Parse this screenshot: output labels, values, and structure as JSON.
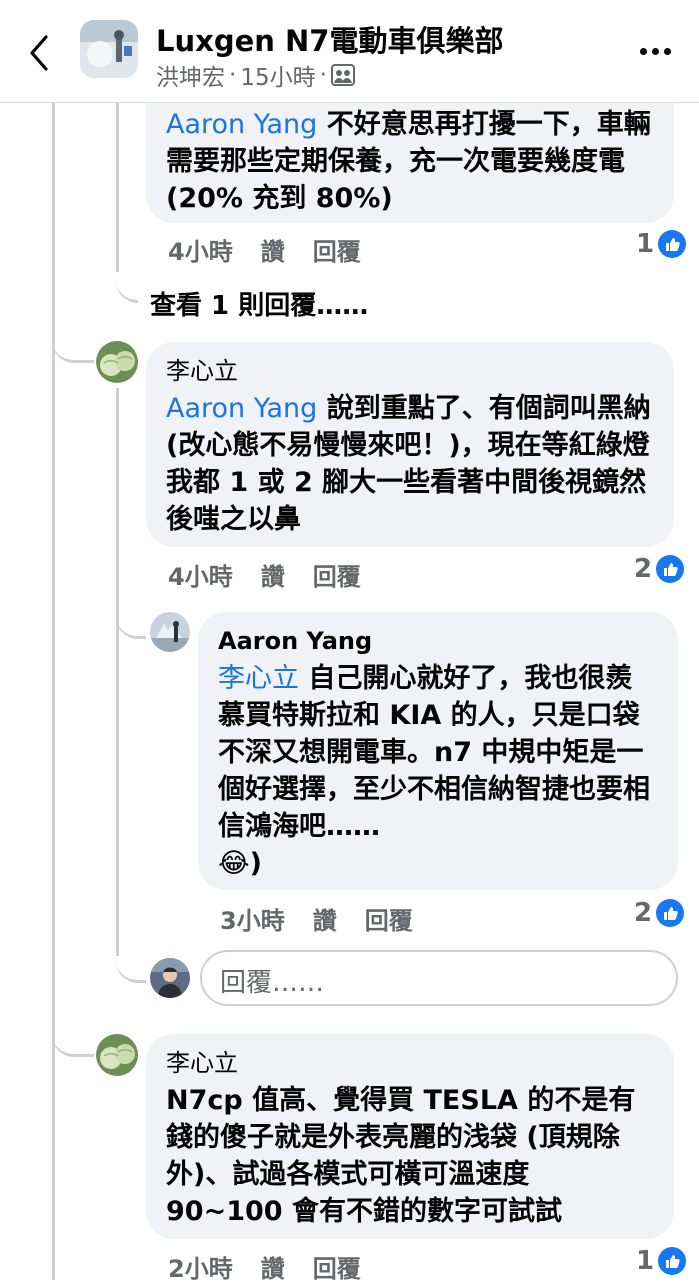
{
  "header": {
    "group_name": "Luxgen N7電動車俱樂部",
    "poster": "洪坤宏",
    "separator": "·",
    "time": "15小時",
    "separator2": "·"
  },
  "comments": [
    {
      "mention": "Aaron Yang",
      "text": " 不好意思再打擾一下，車輛需要那些定期保養，充一次電要幾度電 (20% 充到 80%)",
      "time": "4小時",
      "like": "讚",
      "reply": "回覆",
      "reactions": "1"
    },
    {
      "author": "李心立",
      "mention": "Aaron Yang",
      "text": " 說到重點了、有個詞叫黑納 (改心態不易慢慢來吧！)，現在等紅綠燈我都 1 或 2 腳大一些看著中間後視鏡然後嗤之以鼻",
      "time": "4小時",
      "like": "讚",
      "reply": "回覆",
      "reactions": "2"
    },
    {
      "author": "Aaron Yang",
      "mention": "李心立",
      "text": " 自己開心就好了，我也很羨慕買特斯拉和 KIA 的人，只是口袋不深又想開電車。n7 中規中矩是一個好選擇，至少不相信納智捷也要相信鴻海吧……",
      "emoji": "😂",
      "tail": ")",
      "time": "3小時",
      "like": "讚",
      "reply": "回覆",
      "reactions": "2"
    },
    {
      "author": "李心立",
      "text": "N7cp 值高、覺得買 TESLA 的不是有錢的傻子就是外表亮麗的浅袋 (頂規除外)、試過各模式可橫可溫速度 90~100 會有不錯的數字可試試",
      "time": "2小時",
      "like": "讚",
      "reply": "回覆",
      "reactions": "1"
    }
  ],
  "view_more_replies": "查看 1 則回覆……",
  "reply_placeholder": "回覆……"
}
